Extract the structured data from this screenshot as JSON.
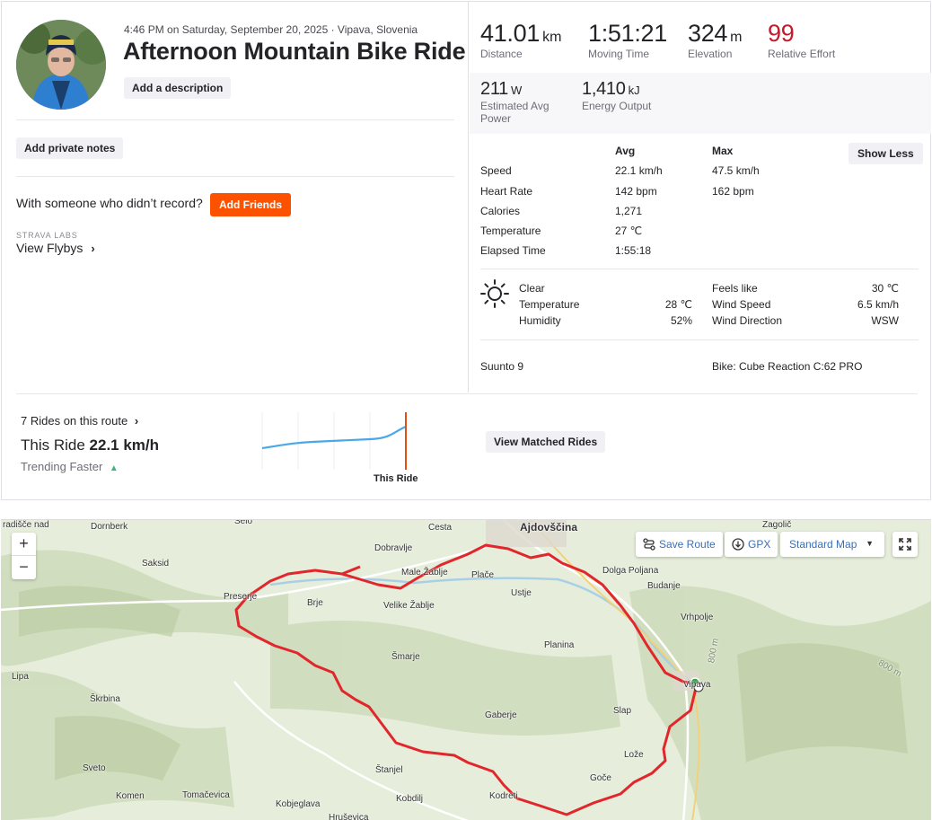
{
  "header": {
    "subtitle": "4:46 PM on Saturday, September 20, 2025 · Vipava, Slovenia",
    "title": "Afternoon Mountain Bike Ride",
    "add_description": "Add a description",
    "add_private_notes": "Add private notes",
    "with_someone": "With someone who didn’t record?",
    "add_friends": "Add Friends",
    "labs_label": "STRAVA LABS",
    "view_flybys": "View Flybys"
  },
  "stats": {
    "distance": {
      "value": "41.01",
      "unit": "km",
      "label": "Distance"
    },
    "moving_time": {
      "value": "1:51:21",
      "label": "Moving Time"
    },
    "elevation": {
      "value": "324",
      "unit": "m",
      "label": "Elevation"
    },
    "relative_effort": {
      "value": "99",
      "label": "Relative Effort",
      "color": "#c21b2c"
    },
    "power": {
      "value": "211",
      "unit": "W",
      "label_line1": "Estimated Avg",
      "label_line2": "Power"
    },
    "energy": {
      "value": "1,410",
      "unit": "kJ",
      "label": "Energy Output"
    }
  },
  "details": {
    "avg_header": "Avg",
    "max_header": "Max",
    "show_less": "Show Less",
    "rows": [
      {
        "label": "Speed",
        "avg": "22.1 km/h",
        "max": "47.5 km/h"
      },
      {
        "label": "Heart Rate",
        "avg": "142 bpm",
        "max": "162 bpm"
      },
      {
        "label": "Calories",
        "avg": "1,271",
        "max": ""
      },
      {
        "label": "Temperature",
        "avg": "27 ℃",
        "max": ""
      },
      {
        "label": "Elapsed Time",
        "avg": "1:55:18",
        "max": ""
      }
    ]
  },
  "weather": {
    "condition": "Clear",
    "temperature_label": "Temperature",
    "temperature": "28 ℃",
    "humidity_label": "Humidity",
    "humidity": "52%",
    "feels_like_label": "Feels like",
    "feels_like": "30 ℃",
    "wind_speed_label": "Wind Speed",
    "wind_speed": "6.5 km/h",
    "wind_direction_label": "Wind Direction",
    "wind_direction": "WSW"
  },
  "device": "Suunto 9",
  "bike": "Bike: Cube Reaction C:62 PRO",
  "route": {
    "rides_link": "7 Rides on this route",
    "this_ride_prefix": "This Ride",
    "this_ride_speed": "22.1 km/h",
    "trend": "Trending Faster",
    "chart_marker": "This Ride",
    "view_matched": "View Matched Rides"
  },
  "map": {
    "save_route": "Save Route",
    "gpx": "GPX",
    "map_type": "Standard Map",
    "zoom_in": "+",
    "zoom_out": "−",
    "places": [
      "radišče nad",
      "Dornberk",
      "Selo",
      "Cesta",
      "Ajdovščina",
      "Zagolič",
      "Saksid",
      "Dobravlje",
      "Male Žablje",
      "Plače",
      "Dolga Poljana",
      "Budanje",
      "Preserje",
      "Brje",
      "Velike Žablje",
      "Ustje",
      "Vrhpolje",
      "Lipa",
      "Šmarje",
      "Planina",
      "Škrbina",
      "Gaberje",
      "Slap",
      "Vipava",
      "Sveto",
      "Lože",
      "Štanjel",
      "Komen",
      "Tomačevica",
      "Kobjeglava",
      "Kobdilj",
      "Goče",
      "Kodreti",
      "Hruševica",
      "800 m",
      "800 m"
    ]
  },
  "colors": {
    "accent": "#fc5200",
    "route": "#e1262c",
    "link": "#3b6fb6"
  }
}
